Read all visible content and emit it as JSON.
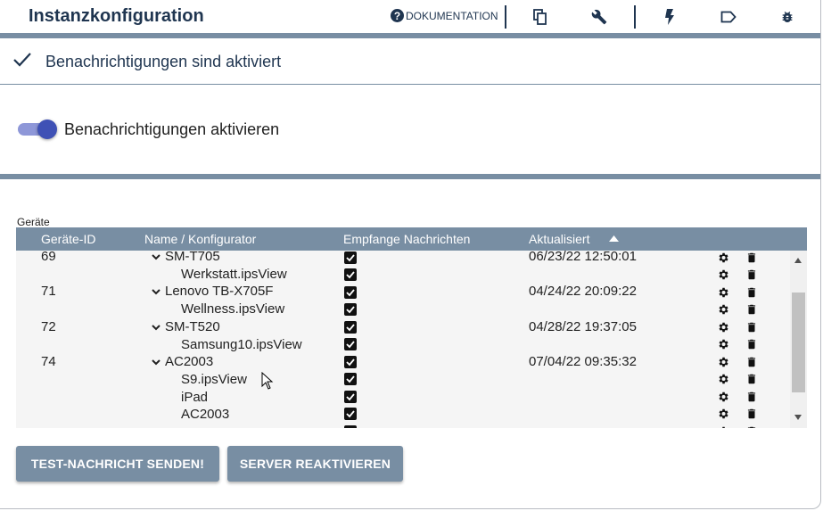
{
  "header": {
    "title": "Instanzkonfiguration",
    "documentation_label": "DOKUMENTATION",
    "icons": [
      "help-icon",
      "copy-icon",
      "wrench-icon",
      "flash-icon",
      "label-icon",
      "bug-icon"
    ]
  },
  "notice": {
    "text": "Benachrichtigungen sind aktiviert"
  },
  "toggle": {
    "label": "Benachrichtigungen aktivieren",
    "on": true
  },
  "devices": {
    "caption": "Geräte",
    "columns": {
      "id": "Geräte-ID",
      "name": "Name / Konfigurator",
      "receive": "Empfange Nachrichten",
      "updated": "Aktualisiert"
    },
    "rows": [
      {
        "id": "69",
        "name": "SM-T705",
        "config": "Werkstatt.ipsView",
        "updated": "06/23/22 12:50:01"
      },
      {
        "id": "71",
        "name": "Lenovo TB-X705F",
        "config": "Wellness.ipsView",
        "updated": "04/24/22 20:09:22"
      },
      {
        "id": "72",
        "name": "SM-T520",
        "config": "Samsung10.ipsView",
        "updated": "04/28/22 19:37:05"
      },
      {
        "id": "74",
        "name": "AC2003",
        "configs": [
          "S9.ipsView",
          "iPad",
          "AC2003"
        ],
        "updated": "07/04/22 09:35:32"
      }
    ]
  },
  "buttons": {
    "test": "TEST-NACHRICHT SENDEN!",
    "reactivate": "SERVER REAKTIVIEREN"
  },
  "colors": {
    "accent": "#788ea3",
    "title": "#1f3550",
    "toggle": "#3f51b5"
  }
}
